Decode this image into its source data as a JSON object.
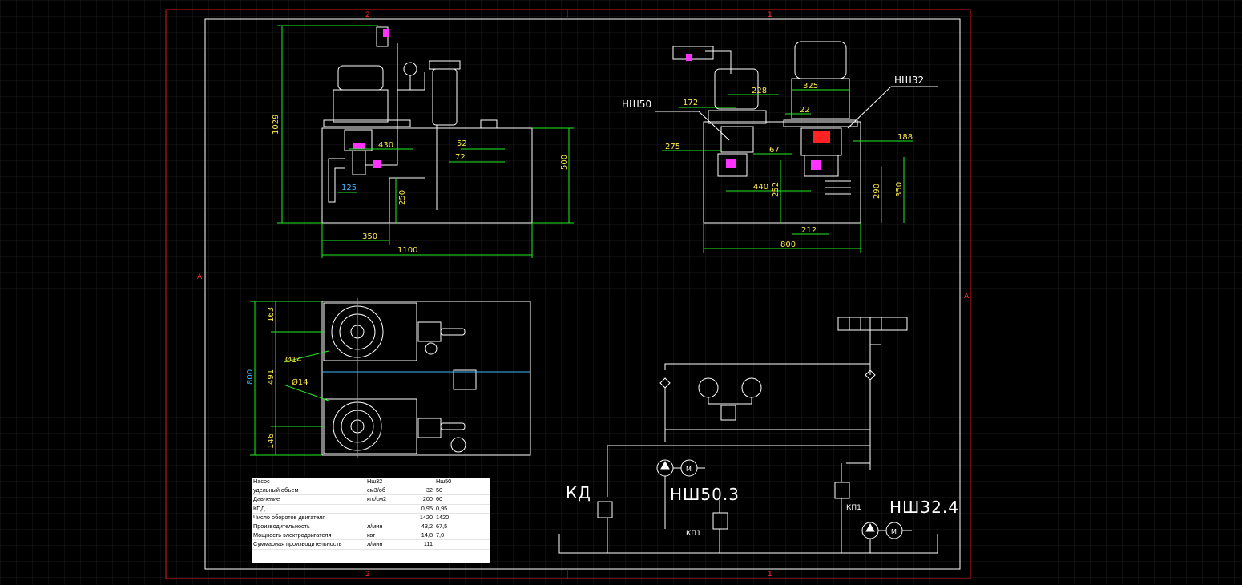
{
  "colors": {
    "background": "#000000",
    "grid": "#1a1a1a",
    "frame_outer": "#e0161b",
    "frame_inner": "#ffffff",
    "dimension": "#22ee22",
    "dimension_text": "#ffe94a",
    "center_line": "#3fb7ff",
    "part": "#ffffff",
    "accent_magenta": "#ff33ff"
  },
  "zone_marks": {
    "top_2": "2",
    "top_1": "1",
    "bottom_2": "2",
    "bottom_1": "1",
    "left_a": "A",
    "right_a": "A"
  },
  "front_view": {
    "dims": {
      "height_total": "1029",
      "d430": "430",
      "d52": "52",
      "d72": "72",
      "d500": "500",
      "d125": "125",
      "d250": "250",
      "d350": "350",
      "d1100": "1100"
    }
  },
  "side_view": {
    "callouts": {
      "pump_left": "НШ50",
      "pump_right": "НШ32"
    },
    "dims": {
      "d172": "172",
      "d228": "228",
      "d325": "325",
      "d22": "22",
      "d275": "275",
      "d67": "67",
      "d188": "188",
      "d440": "440",
      "d252": "252",
      "d290": "290",
      "d350": "350",
      "d212": "212",
      "d800": "800"
    }
  },
  "top_view": {
    "dims": {
      "d163": "163",
      "d800": "800",
      "d491": "491",
      "d146": "146",
      "hole_1": "Ø14",
      "hole_2": "Ø14"
    }
  },
  "schematic": {
    "kd": "КД",
    "pump_50": "НШ50.3",
    "pump_32": "НШ32.4",
    "relief_1": "КП1",
    "relief_2": "КП1",
    "motor": "M",
    "motor_2": "M"
  },
  "spec_table": {
    "rows": [
      {
        "name": "Насос",
        "unit": "Нш32",
        "v1": "",
        "v2": "Нш50"
      },
      {
        "name": "удельный объем",
        "unit": "см3/об",
        "v1": "32",
        "v2": "50"
      },
      {
        "name": "Давление",
        "unit": "кгс/см2",
        "v1": "200",
        "v2": "60"
      },
      {
        "name": "КПД",
        "unit": "",
        "v1": "0,95",
        "v2": "0,95"
      },
      {
        "name": "Число оборотов двигателя",
        "unit": "",
        "v1": "1420",
        "v2": "1420"
      },
      {
        "name": "Производительность",
        "unit": "л/мин",
        "v1": "43,2",
        "v2": "67,5"
      },
      {
        "name": "Мощность электродвигателя",
        "unit": "квт",
        "v1": "14,8",
        "v2": "7,0"
      },
      {
        "name": "Суммарная производительность",
        "unit": "л/мин",
        "v1": "111",
        "v2": ""
      }
    ]
  }
}
